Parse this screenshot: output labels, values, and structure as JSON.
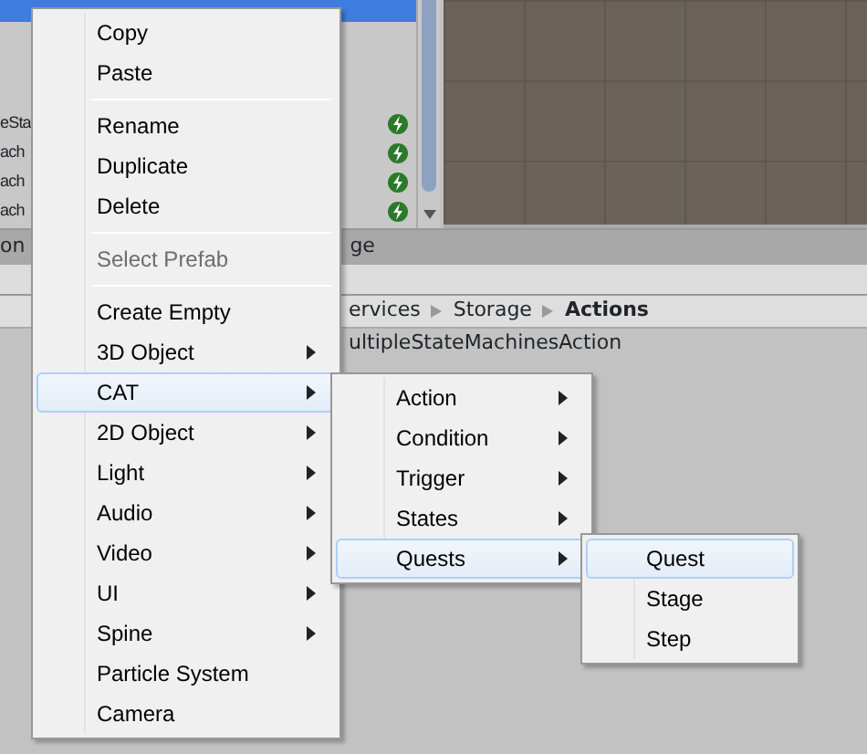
{
  "hierarchy": {
    "rows": [
      {
        "text": "eSta",
        "selected": false
      },
      {
        "text": "ach",
        "selected": false
      },
      {
        "text": "ach",
        "selected": false
      },
      {
        "text": "ach",
        "selected": false
      }
    ]
  },
  "panel_tabs": [
    "on",
    "ge"
  ],
  "breadcrumb": [
    {
      "text": "ervices",
      "current": false
    },
    {
      "text": "Storage",
      "current": false
    },
    {
      "text": "Actions",
      "current": true
    }
  ],
  "project_items": [
    "ultipleStateMachinesAction"
  ],
  "menus": [
    {
      "items": [
        {
          "kind": "item",
          "label": "Copy",
          "submenu": false,
          "disabled": false,
          "selected": false
        },
        {
          "kind": "item",
          "label": "Paste",
          "submenu": false,
          "disabled": false,
          "selected": false
        },
        {
          "kind": "separator"
        },
        {
          "kind": "item",
          "label": "Rename",
          "submenu": false,
          "disabled": false,
          "selected": false
        },
        {
          "kind": "item",
          "label": "Duplicate",
          "submenu": false,
          "disabled": false,
          "selected": false
        },
        {
          "kind": "item",
          "label": "Delete",
          "submenu": false,
          "disabled": false,
          "selected": false
        },
        {
          "kind": "separator"
        },
        {
          "kind": "item",
          "label": "Select Prefab",
          "submenu": false,
          "disabled": true,
          "selected": false
        },
        {
          "kind": "separator"
        },
        {
          "kind": "item",
          "label": "Create Empty",
          "submenu": false,
          "disabled": false,
          "selected": false
        },
        {
          "kind": "item",
          "label": "3D Object",
          "submenu": true,
          "disabled": false,
          "selected": false
        },
        {
          "kind": "item",
          "label": "CAT",
          "submenu": true,
          "disabled": false,
          "selected": true
        },
        {
          "kind": "item",
          "label": "2D Object",
          "submenu": true,
          "disabled": false,
          "selected": false
        },
        {
          "kind": "item",
          "label": "Light",
          "submenu": true,
          "disabled": false,
          "selected": false
        },
        {
          "kind": "item",
          "label": "Audio",
          "submenu": true,
          "disabled": false,
          "selected": false
        },
        {
          "kind": "item",
          "label": "Video",
          "submenu": true,
          "disabled": false,
          "selected": false
        },
        {
          "kind": "item",
          "label": "UI",
          "submenu": true,
          "disabled": false,
          "selected": false
        },
        {
          "kind": "item",
          "label": "Spine",
          "submenu": true,
          "disabled": false,
          "selected": false
        },
        {
          "kind": "item",
          "label": "Particle System",
          "submenu": false,
          "disabled": false,
          "selected": false
        },
        {
          "kind": "item",
          "label": "Camera",
          "submenu": false,
          "disabled": false,
          "selected": false
        }
      ]
    },
    {
      "items": [
        {
          "kind": "item",
          "label": "Action",
          "submenu": true,
          "disabled": false,
          "selected": false
        },
        {
          "kind": "item",
          "label": "Condition",
          "submenu": true,
          "disabled": false,
          "selected": false
        },
        {
          "kind": "item",
          "label": "Trigger",
          "submenu": true,
          "disabled": false,
          "selected": false
        },
        {
          "kind": "item",
          "label": "States",
          "submenu": true,
          "disabled": false,
          "selected": false
        },
        {
          "kind": "item",
          "label": "Quests",
          "submenu": true,
          "disabled": false,
          "selected": true
        }
      ]
    },
    {
      "items": [
        {
          "kind": "item",
          "label": "Quest",
          "submenu": false,
          "disabled": false,
          "selected": true
        },
        {
          "kind": "item",
          "label": "Stage",
          "submenu": false,
          "disabled": false,
          "selected": false
        },
        {
          "kind": "item",
          "label": "Step",
          "submenu": false,
          "disabled": false,
          "selected": false
        }
      ]
    }
  ]
}
